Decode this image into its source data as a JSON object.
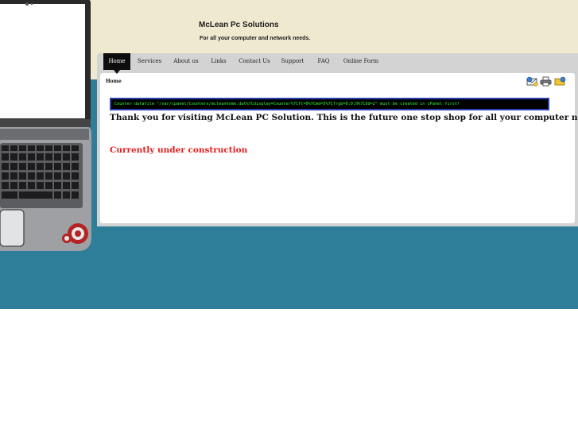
{
  "site": {
    "title": "McLean Pc Solutions",
    "tagline": "For all your computer and network needs."
  },
  "nav": {
    "items": [
      {
        "label": "Home",
        "active": true
      },
      {
        "label": "Services"
      },
      {
        "label": "About us"
      },
      {
        "label": "Links"
      },
      {
        "label": "Contact Us"
      },
      {
        "label": "Support"
      },
      {
        "label": "FAQ"
      },
      {
        "label": "Online Form"
      }
    ]
  },
  "page": {
    "breadcrumb": "Home",
    "counter_error": "Counter datafile \"/var/cpanel/Counters/mcleanhome.dat%7Cdisplay=Counter%7Cft=0%7Cmd=5%7Cfrgb=0;0;0%7Cdd=2\" must be created in cPanel first!",
    "welcome": "Thank you for visiting McLean PC Solution. This is the future one stop shop for all your computer needs.",
    "construction": "Currently under construction"
  },
  "icons": [
    "email-page-icon",
    "print-page-icon",
    "bookmark-page-icon"
  ],
  "colors": {
    "top_band": "#efe9cf",
    "blue_band": "#2f7e99",
    "nav_active": "#0d0d0d",
    "counter_text": "#31ff31",
    "construction": "#e81c1c"
  }
}
